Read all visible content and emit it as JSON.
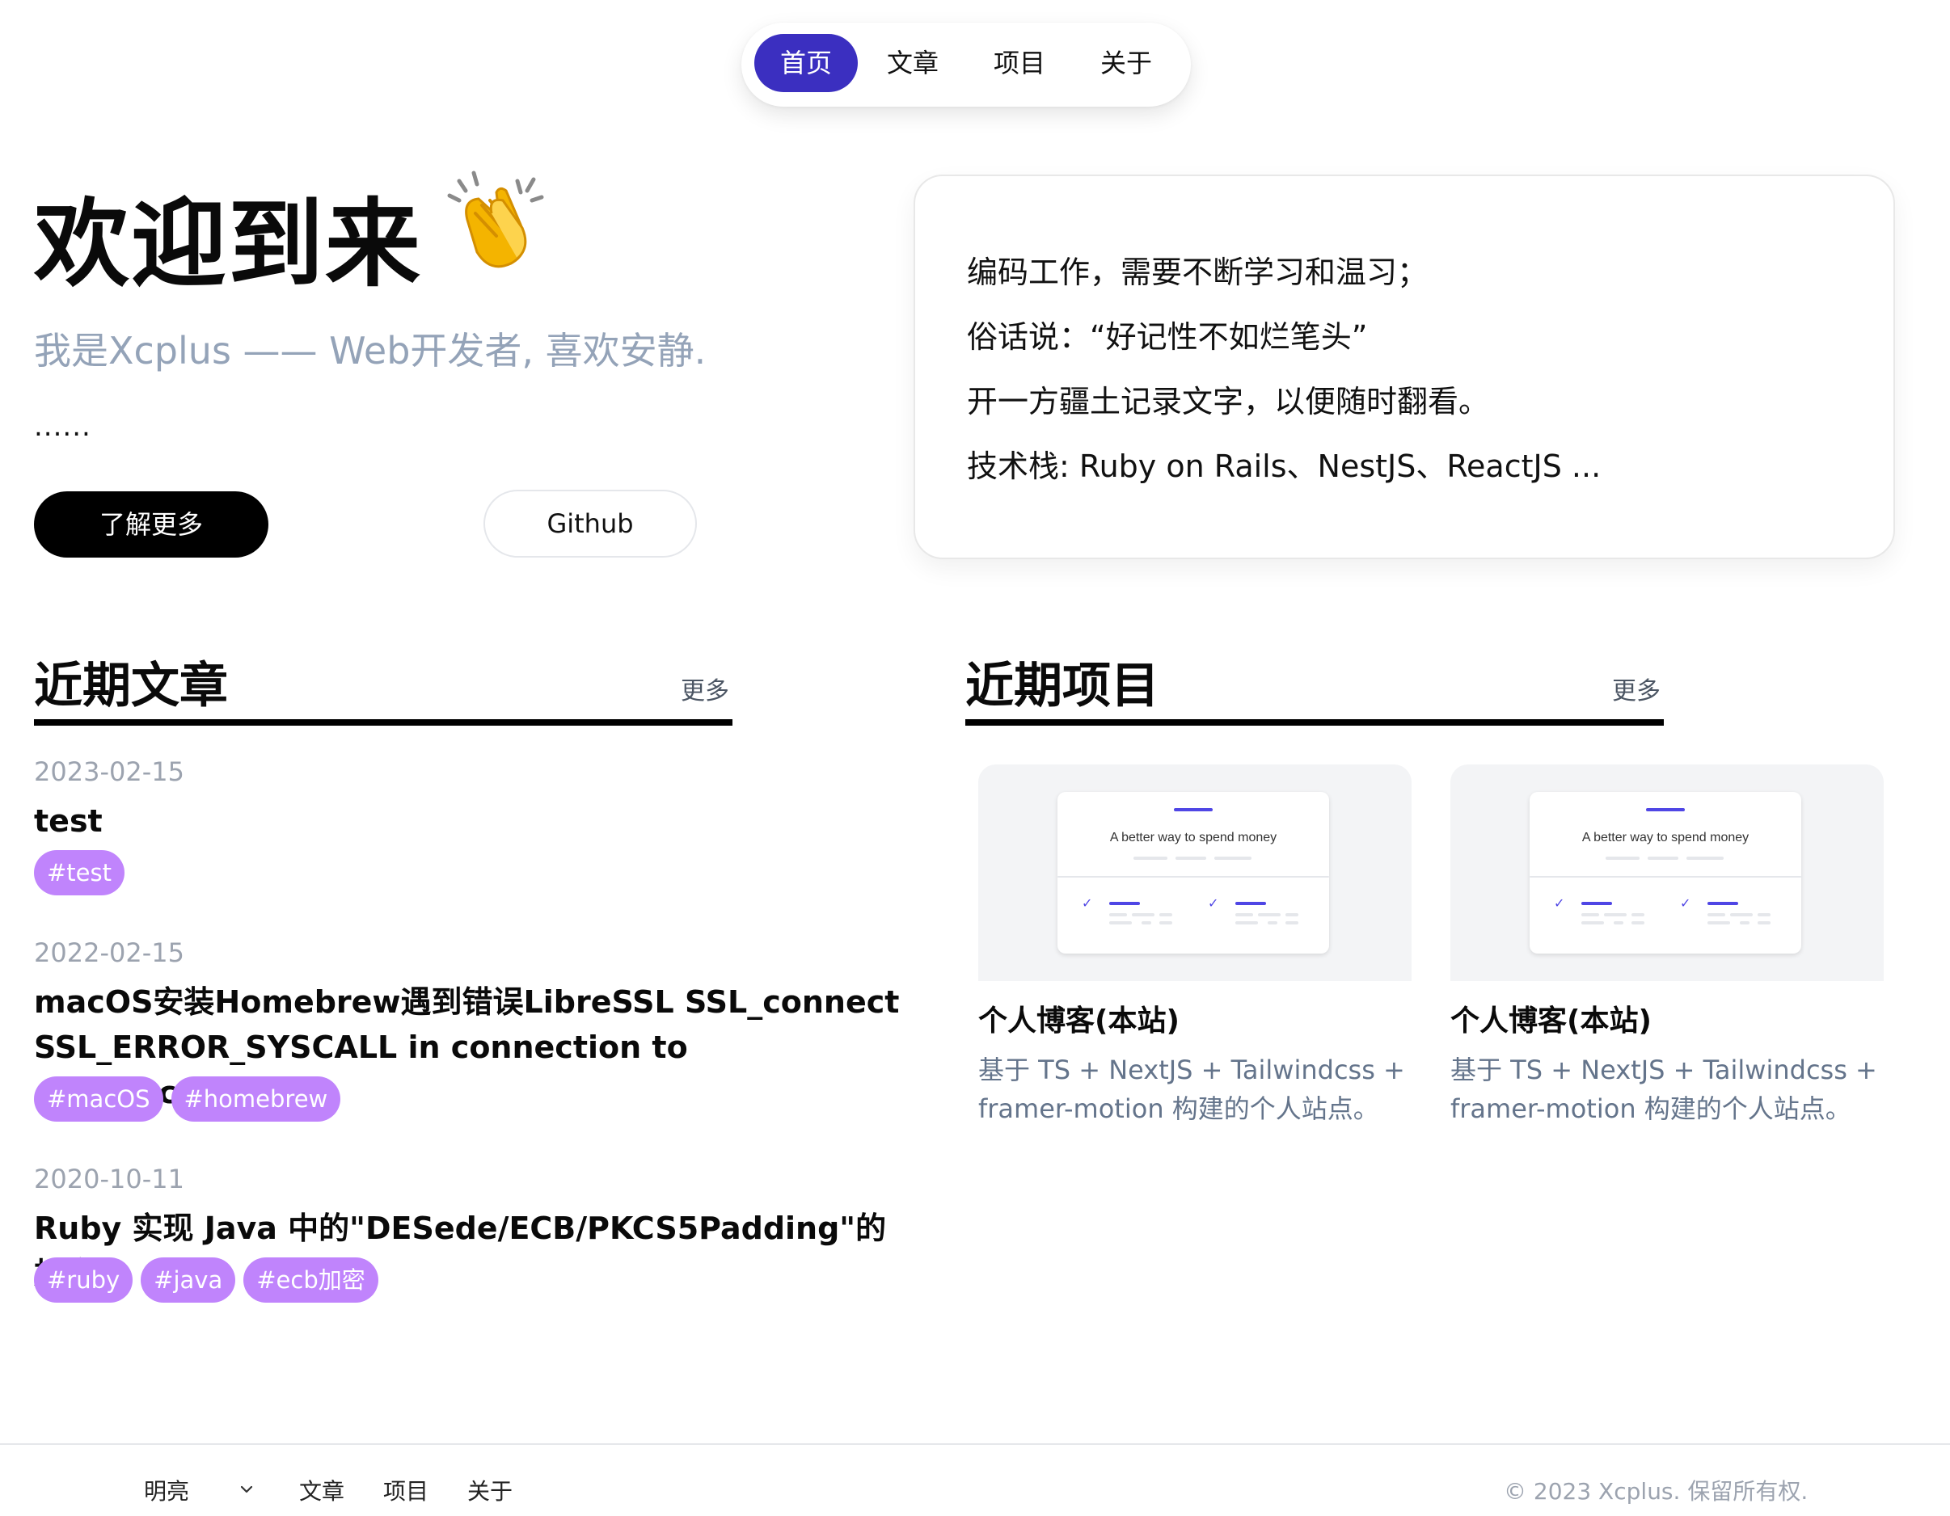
{
  "nav": {
    "items": [
      {
        "label": "首页",
        "active": true
      },
      {
        "label": "文章",
        "active": false
      },
      {
        "label": "项目",
        "active": false
      },
      {
        "label": "关于",
        "active": false
      }
    ],
    "active_color": "#3b2fc0"
  },
  "hero": {
    "title": "欢迎到来",
    "emoji": "clapping-hands",
    "subtitle": "我是Xcplus —— Web开发者, 喜欢安静.",
    "ellipsis": "......",
    "primary_button": "了解更多",
    "secondary_button": "Github"
  },
  "intro_card": {
    "lines": [
      "编码工作，需要不断学习和温习；",
      "俗话说：“好记性不如烂笔头”",
      "开一方疆土记录文字，以便随时翻看。",
      "技术栈: Ruby on Rails、NestJS、ReactJS ..."
    ]
  },
  "recent_posts": {
    "title": "近期文章",
    "more": "更多",
    "posts": [
      {
        "date": "2023-02-15",
        "title": "test",
        "tags": [
          "#test"
        ]
      },
      {
        "date": "2022-02-15",
        "title": "macOS安装Homebrew遇到错误LibreSSL SSL_connect SSL_ERROR_SYSCALL in connection to github.com:443",
        "tags": [
          "#macOS",
          "#homebrew"
        ]
      },
      {
        "date": "2020-10-11",
        "title": "Ruby 实现 Java 中的\"DESede/ECB/PKCS5Padding\"的加密",
        "tags": [
          "#ruby",
          "#java",
          "#ecb加密"
        ]
      }
    ],
    "tag_color": "#c084fc"
  },
  "recent_projects": {
    "title": "近期项目",
    "more": "更多",
    "projects": [
      {
        "name": "个人博客(本站)",
        "description": "基于 TS + NextJS + Tailwindcss + framer-motion 构建的个人站点。",
        "thumb_text": "A better way to spend money"
      },
      {
        "name": "个人博客(本站)",
        "description": "基于 TS + NextJS + Tailwindcss + framer-motion 构建的个人站点。",
        "thumb_text": "A better way to spend money"
      }
    ]
  },
  "footer": {
    "theme_label": "明亮",
    "links": [
      "文章",
      "项目",
      "关于"
    ],
    "copyright": "© 2023 Xcplus. 保留所有权."
  }
}
